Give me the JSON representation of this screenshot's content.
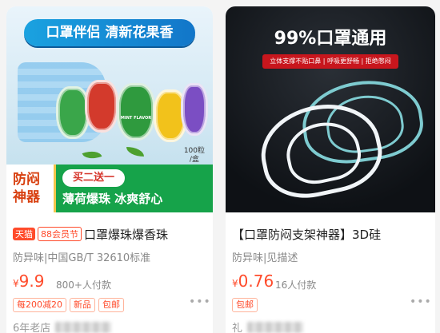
{
  "left_card": {
    "banner_text": "口罩伴侣 清新花果香",
    "product_flavor_label": "MINT FLAVOR",
    "count_tag": [
      "100粒",
      "/盒"
    ],
    "promo_side": [
      "防闷",
      "神器"
    ],
    "buy_offer": "买二送一",
    "slogan": "薄荷爆珠 冰爽舒心",
    "badge_tmall": "天猫",
    "badge_88": "88会员节",
    "title": "口罩爆珠爆香珠",
    "attrs": "防异味|中国GB/T 32610标准",
    "price_symbol": "¥",
    "price": "9.9",
    "buyers": "800+人付款",
    "chips": [
      "每200减20",
      "新品",
      "包邮"
    ],
    "more": "•••",
    "shop": "6年老店"
  },
  "right_card": {
    "header": "99%口罩通用",
    "subheader": "立体支撑不贴口鼻 | 呼吸更舒畅 | 拒绝憋闷",
    "title": "【口罩防闷支架神器】3D硅",
    "attrs": "防异味|见描述",
    "price_symbol": "¥",
    "price": "0.76",
    "buyers": "16人付款",
    "chips": [
      "包邮"
    ],
    "more": "•••",
    "shop": "礼"
  },
  "colors": {
    "accent": "#ff4b2b",
    "promo_green": "#16a34a",
    "banner_blue": "#1aa2e0"
  }
}
